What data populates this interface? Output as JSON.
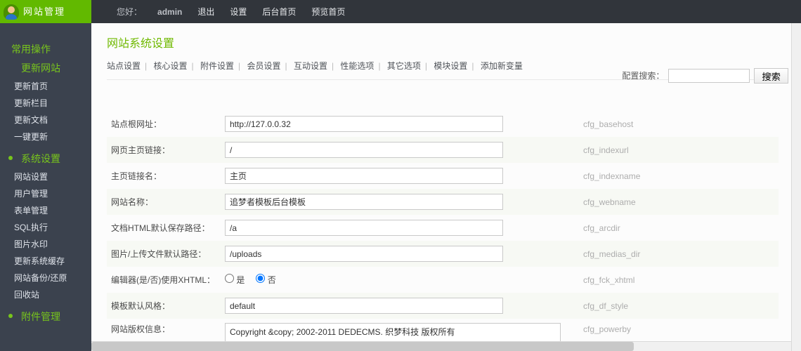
{
  "header": {
    "logo": "网站管理",
    "welcome_label": "您好：",
    "user": "admin",
    "links": [
      "退出",
      "设置",
      "后台首页",
      "预览首页"
    ]
  },
  "sidebar": {
    "groups": [
      {
        "head": "常用操作",
        "sub": "更新网站",
        "items": [
          "更新首页",
          "更新栏目",
          "更新文档",
          "一键更新"
        ]
      },
      {
        "head": "系统设置",
        "items": [
          "网站设置",
          "用户管理",
          "表单管理",
          "SQL执行",
          "图片水印",
          "更新系统缓存",
          "网站备份/还原",
          "回收站"
        ]
      },
      {
        "head": "附件管理",
        "items": []
      }
    ]
  },
  "page": {
    "title": "网站系统设置",
    "tabs": [
      "站点设置",
      "核心设置",
      "附件设置",
      "会员设置",
      "互动设置",
      "性能选项",
      "其它选项",
      "模块设置",
      "添加新变量"
    ],
    "search_label": "配置搜索：",
    "search_btn": "搜索"
  },
  "rows": [
    {
      "label": "站点根网址：",
      "type": "text",
      "value": "http://127.0.0.32",
      "key": "cfg_basehost"
    },
    {
      "label": "网页主页链接：",
      "type": "text",
      "value": "/",
      "key": "cfg_indexurl"
    },
    {
      "label": "主页链接名：",
      "type": "text",
      "value": "主页",
      "key": "cfg_indexname"
    },
    {
      "label": "网站名称：",
      "type": "text",
      "value": "追梦者模板后台模板",
      "key": "cfg_webname"
    },
    {
      "label": "文档HTML默认保存路径：",
      "type": "text",
      "value": "/a",
      "key": "cfg_arcdir"
    },
    {
      "label": "图片/上传文件默认路径：",
      "type": "text",
      "value": "/uploads",
      "key": "cfg_medias_dir"
    },
    {
      "label": "编辑器(是/否)使用XHTML：",
      "type": "radio",
      "opt_yes": "是",
      "opt_no": "否",
      "value": "no",
      "key": "cfg_fck_xhtml"
    },
    {
      "label": "模板默认风格：",
      "type": "text",
      "value": "default",
      "key": "cfg_df_style"
    },
    {
      "label": "网站版权信息：",
      "type": "textarea",
      "value": "Copyright &copy; 2002-2011 DEDECMS. 织梦科技 版权所有",
      "key": "cfg_powerby"
    }
  ]
}
